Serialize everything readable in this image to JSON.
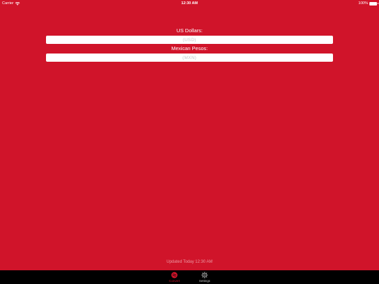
{
  "status_bar": {
    "carrier": "Carrier",
    "time": "12:30 AM",
    "battery": "100%"
  },
  "usd": {
    "label": "US Dollars:",
    "placeholder": "(USD)",
    "value": ""
  },
  "mxn": {
    "label": "Mexican Pesos:",
    "placeholder": "(MXN)",
    "value": ""
  },
  "updated_text": "Updated Today 12:30 AM",
  "tabs": [
    {
      "label": "Convert",
      "icon": "convert-icon",
      "selected": true
    },
    {
      "label": "Settings",
      "icon": "gear-icon",
      "selected": false
    }
  ],
  "colors": {
    "background": "#d0142a",
    "tab_bar": "#000000",
    "tab_selected": "#d0142a",
    "tab_unselected": "#bfbfbf"
  }
}
